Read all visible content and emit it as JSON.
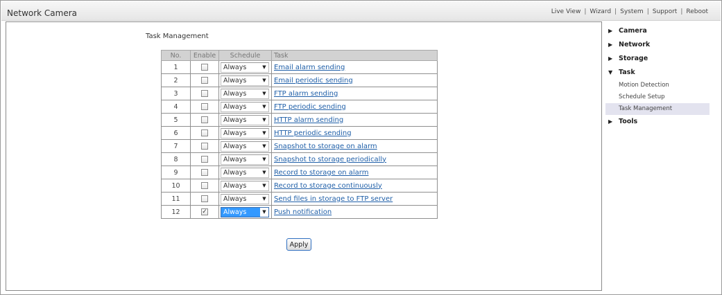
{
  "header": {
    "title": "Network Camera",
    "nav": [
      "Live View",
      "Wizard",
      "System",
      "Support",
      "Reboot"
    ]
  },
  "page": {
    "title": "Task Management",
    "columns": [
      "No.",
      "Enable",
      "Schedule",
      "Task"
    ],
    "rows": [
      {
        "no": "1",
        "enabled": false,
        "schedule": "Always",
        "task": "Email alarm sending"
      },
      {
        "no": "2",
        "enabled": false,
        "schedule": "Always",
        "task": "Email periodic sending"
      },
      {
        "no": "3",
        "enabled": false,
        "schedule": "Always",
        "task": "FTP alarm sending"
      },
      {
        "no": "4",
        "enabled": false,
        "schedule": "Always",
        "task": "FTP periodic sending"
      },
      {
        "no": "5",
        "enabled": false,
        "schedule": "Always",
        "task": "HTTP alarm sending"
      },
      {
        "no": "6",
        "enabled": false,
        "schedule": "Always",
        "task": "HTTP periodic sending"
      },
      {
        "no": "7",
        "enabled": false,
        "schedule": "Always",
        "task": "Snapshot to storage on alarm"
      },
      {
        "no": "8",
        "enabled": false,
        "schedule": "Always",
        "task": "Snapshot to storage periodically"
      },
      {
        "no": "9",
        "enabled": false,
        "schedule": "Always",
        "task": "Record to storage on alarm"
      },
      {
        "no": "10",
        "enabled": false,
        "schedule": "Always",
        "task": "Record to storage continuously"
      },
      {
        "no": "11",
        "enabled": false,
        "schedule": "Always",
        "task": "Send files in storage to FTP server"
      },
      {
        "no": "12",
        "enabled": true,
        "schedule": "Always",
        "task": "Push notification"
      }
    ],
    "apply_label": "Apply"
  },
  "sidebar": {
    "items": [
      {
        "label": "Camera",
        "expanded": false
      },
      {
        "label": "Network",
        "expanded": false
      },
      {
        "label": "Storage",
        "expanded": false
      },
      {
        "label": "Task",
        "expanded": true,
        "children": [
          "Motion Detection",
          "Schedule Setup",
          "Task Management"
        ]
      },
      {
        "label": "Tools",
        "expanded": false
      }
    ],
    "selected_child": "Task Management"
  },
  "colors": {
    "link": "#1f5fa8",
    "selected_bg": "#e3e3ef",
    "focused_select": "#3399ff"
  },
  "icons": {
    "collapsed": "triangle-right-icon",
    "expanded": "triangle-down-icon",
    "dropdown": "chevron-down-icon"
  }
}
